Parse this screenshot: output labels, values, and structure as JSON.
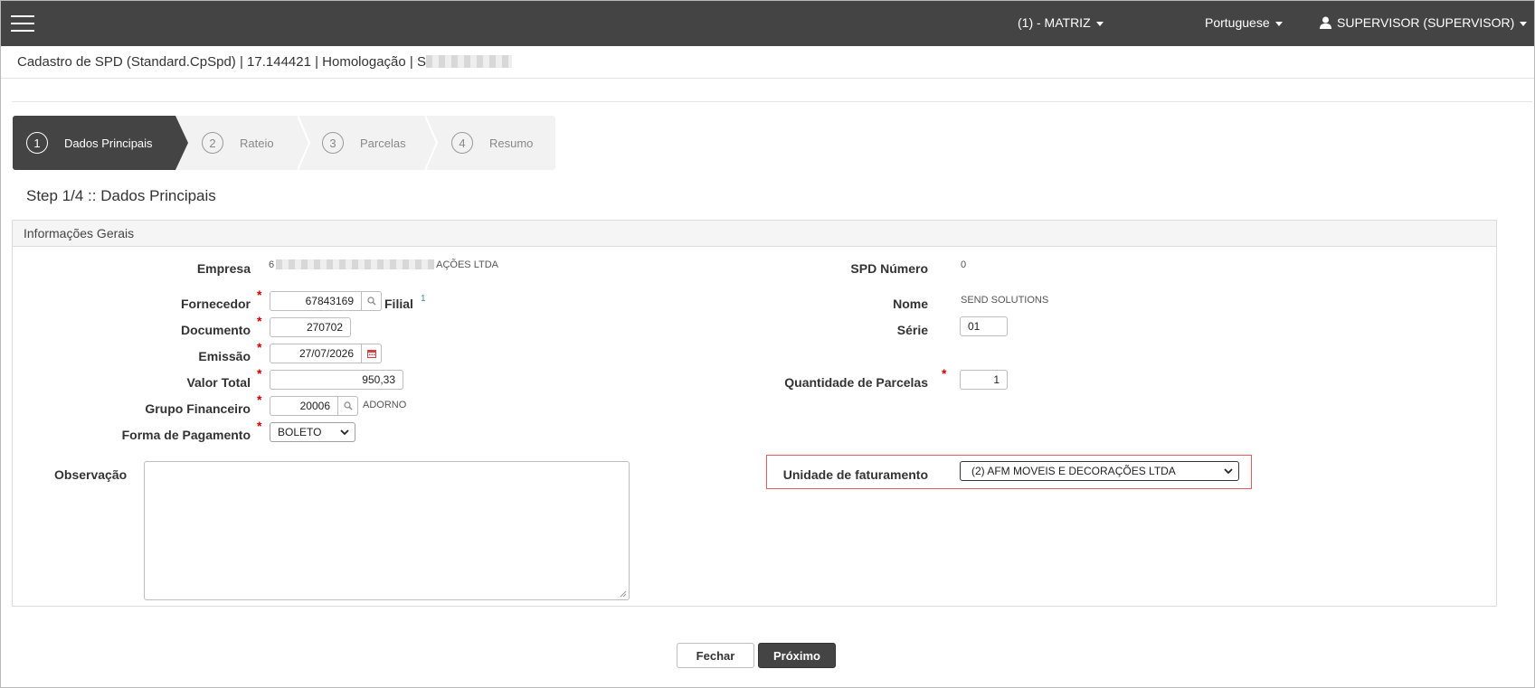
{
  "topbar": {
    "company_selector": "(1) - MATRIZ",
    "language": "Portuguese",
    "user": "SUPERVISOR (SUPERVISOR)"
  },
  "header": {
    "title": "Cadastro de SPD (Standard.CpSpd) | 17.144421 | Homologação | S"
  },
  "wizard": {
    "steps": [
      {
        "number": "1",
        "label": "Dados Principais"
      },
      {
        "number": "2",
        "label": "Rateio"
      },
      {
        "number": "3",
        "label": "Parcelas"
      },
      {
        "number": "4",
        "label": "Resumo"
      }
    ],
    "active_index": 0,
    "step_title": "Step 1/4 :: Dados Principais"
  },
  "panel": {
    "title": "Informações Gerais"
  },
  "form": {
    "empresa": {
      "label": "Empresa",
      "value_prefix": "6",
      "value_suffix": "AÇÕES LTDA"
    },
    "fornecedor": {
      "label": "Fornecedor",
      "value": "67843169",
      "filial_label": "Filial",
      "filial_value": "1"
    },
    "documento": {
      "label": "Documento",
      "value": "270702"
    },
    "emissao": {
      "label": "Emissão",
      "value": "27/07/2026"
    },
    "valor_total": {
      "label": "Valor Total",
      "value": "950,33"
    },
    "grupo_financeiro": {
      "label": "Grupo Financeiro",
      "value": "20006",
      "description": "ADORNO"
    },
    "forma_pagamento": {
      "label": "Forma de Pagamento",
      "value": "BOLETO"
    },
    "observacao": {
      "label": "Observação",
      "value": ""
    },
    "spd_numero": {
      "label": "SPD Número",
      "value": "0"
    },
    "nome": {
      "label": "Nome",
      "value": "SEND SOLUTIONS"
    },
    "serie": {
      "label": "Série",
      "value": "01"
    },
    "qtd_parcelas": {
      "label": "Quantidade de Parcelas",
      "value": "1"
    },
    "unidade_faturamento": {
      "label": "Unidade de faturamento",
      "value": "(2) AFM MOVEIS E DECORAÇÕES LTDA"
    }
  },
  "buttons": {
    "close": "Fechar",
    "next": "Próximo"
  },
  "colors": {
    "topbar": "#444444",
    "required": "#d40000",
    "highlight": "#e8595d"
  }
}
